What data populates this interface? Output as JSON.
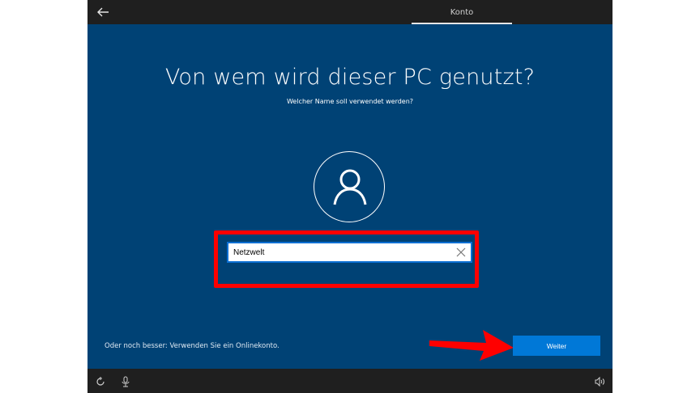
{
  "topbar": {
    "back_icon": "arrow-left-icon",
    "tab_label": "Konto"
  },
  "main": {
    "title": "Von wem wird dieser PC genutzt?",
    "subtitle": "Welcher Name soll verwendet werden?",
    "avatar_icon": "user-icon",
    "name_input": {
      "value": "Netzwelt",
      "clear_icon": "close-icon"
    }
  },
  "footer": {
    "online_link": "Oder noch besser: Verwenden Sie ein Onlinekonto.",
    "next_label": "Weiter"
  },
  "bottombar": {
    "icons": [
      "ease-of-access-icon",
      "microphone-icon",
      "volume-icon"
    ]
  },
  "annotations": {
    "highlight_color": "#ff0000",
    "arrow_color": "#ff0000"
  },
  "colors": {
    "background": "#004275",
    "accent": "#0078d7",
    "bar": "#1f1f1f"
  }
}
